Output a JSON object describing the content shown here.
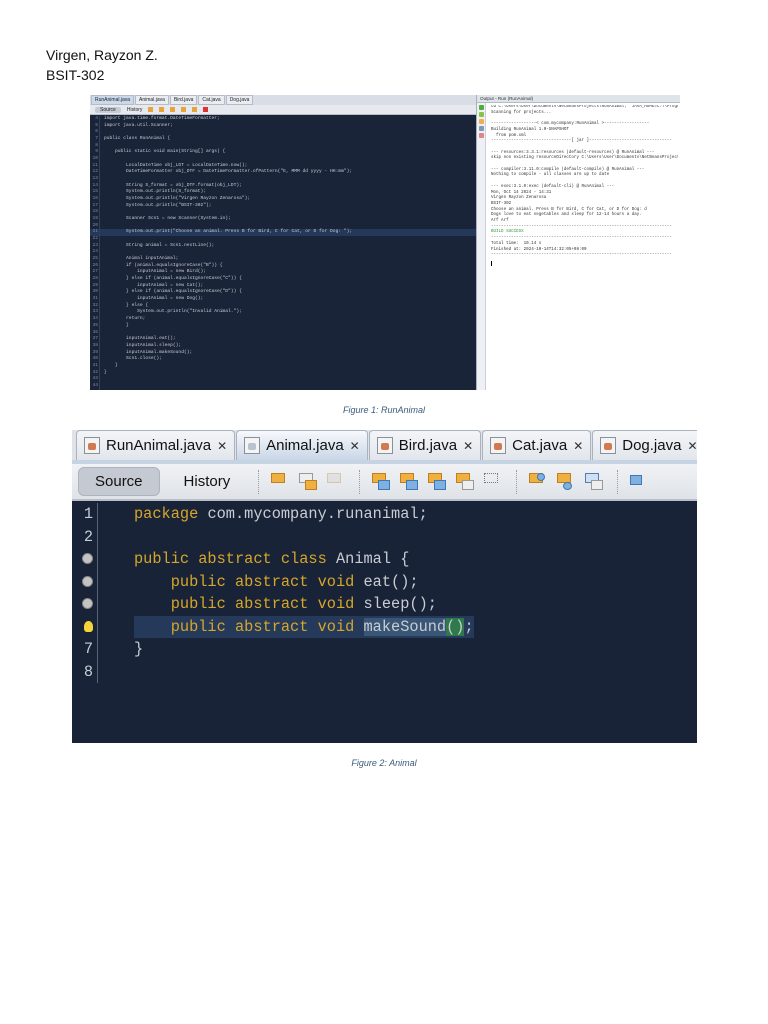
{
  "author": {
    "name": "Virgen, Rayzon Z.",
    "section": "BSIT-302"
  },
  "figure1": {
    "caption": "Figure 1: RunAnimal",
    "tabs": [
      "RunAnimal.java",
      "Animal.java",
      "Bird.java",
      "Cat.java",
      "Dog.java"
    ],
    "active_tab": 0,
    "toolbar": {
      "source_label": "Source",
      "history_label": "History"
    },
    "code_lines": [
      {
        "n": "4",
        "code": "import java.time.format.DateTimeFormatter;"
      },
      {
        "n": "5",
        "code": "import java.util.Scanner;"
      },
      {
        "n": "6",
        "code": ""
      },
      {
        "n": "7",
        "code": "public class RunAnimal {"
      },
      {
        "n": "8",
        "code": ""
      },
      {
        "n": "9",
        "code": "    public static void main(String[] args) {"
      },
      {
        "n": "10",
        "code": ""
      },
      {
        "n": "11",
        "code": "        LocalDateTime obj_LDT = LocalDateTime.now();"
      },
      {
        "n": "12",
        "code": "        DateTimeFormatter obj_DTF = DateTimeFormatter.ofPattern(\"E, MMM dd yyyy - HH:mm\");"
      },
      {
        "n": "13",
        "code": ""
      },
      {
        "n": "14",
        "code": "        String S_format = obj_DTF.format(obj_LDT);"
      },
      {
        "n": "15",
        "code": "        System.out.println(S_format);"
      },
      {
        "n": "16",
        "code": "        System.out.println(\"Virgen Rayzon Zenarosa\");"
      },
      {
        "n": "17",
        "code": "        System.out.println(\"BSIT-302\");"
      },
      {
        "n": "18",
        "code": ""
      },
      {
        "n": "19",
        "code": "        Scanner Scn1 = new Scanner(System.in);"
      },
      {
        "n": "20",
        "code": ""
      },
      {
        "n": "21",
        "code": "        System.out.print(\"Choose an animal. Press B for Bird, C for Cat, or D for Dog: \");",
        "hl": true
      },
      {
        "n": "22",
        "code": ""
      },
      {
        "n": "23",
        "code": "        String animal = Scn1.nextLine();"
      },
      {
        "n": "24",
        "code": ""
      },
      {
        "n": "25",
        "code": "        Animal inputAnimal;"
      },
      {
        "n": "26",
        "code": "        if (animal.equalsIgnoreCase(\"B\")) {"
      },
      {
        "n": "27",
        "code": "            inputAnimal = new Bird();"
      },
      {
        "n": "28",
        "code": "        } else if (animal.equalsIgnoreCase(\"C\")) {"
      },
      {
        "n": "29",
        "code": "            inputAnimal = new Cat();"
      },
      {
        "n": "30",
        "code": "        } else if (animal.equalsIgnoreCase(\"D\")) {"
      },
      {
        "n": "31",
        "code": "            inputAnimal = new Dog();"
      },
      {
        "n": "32",
        "code": "        } else {"
      },
      {
        "n": "33",
        "code": "            System.out.println(\"Invalid Animal.\");"
      },
      {
        "n": "34",
        "code": "        return;"
      },
      {
        "n": "35",
        "code": "        }"
      },
      {
        "n": "36",
        "code": ""
      },
      {
        "n": "37",
        "code": "        inputAnimal.eat();"
      },
      {
        "n": "38",
        "code": "        inputAnimal.sleep();"
      },
      {
        "n": "39",
        "code": "        inputAnimal.makeSound();"
      },
      {
        "n": "40",
        "code": "        Scn1.close();"
      },
      {
        "n": "41",
        "code": "    }"
      },
      {
        "n": "42",
        "code": "}"
      },
      {
        "n": "43",
        "code": ""
      },
      {
        "n": "44",
        "code": ""
      }
    ],
    "output": {
      "title": "Output - Run (RunAnimal)",
      "lines": [
        "cd C:\\Users\\User\\Documents\\NetBeansProjects\\RunAnimal; \"JAVA_HOME=C:\\\\Progra",
        "Scanning for projects...",
        "",
        "------------------< com.mycompany:RunAnimal >------------------",
        "Building RunAnimal 1.0-SNAPSHOT",
        "  from pom.xml",
        "--------------------------------[ jar ]---------------------------------",
        "",
        "--- resources:3.3.1:resources (default-resources) @ RunAnimal ---",
        "skip non existing resourceDirectory C:\\Users\\User\\Documents\\NetBeansProjects",
        "",
        "--- compiler:3.11.0:compile (default-compile) @ RunAnimal ---",
        "Nothing to compile - all classes are up to date",
        "",
        "--- exec:3.1.0:exec (default-cli) @ RunAnimal ---",
        "Mon, Oct 14 2024 - 14:31",
        "Virgen Rayzon Zenarosa",
        "BSIT-302",
        "Choose an animal. Press B for Bird, C for Cat, or D for Dog: d",
        "Dogs love to eat vegetables and sleep for 12-14 hours a day.",
        "Arf Arf",
        "------------------------------------------------------------------------",
        "BUILD SUCCESS",
        "------------------------------------------------------------------------",
        "Total time:  10.14 s",
        "Finished at: 2024-10-14T14:32:05+08:00",
        "------------------------------------------------------------------------"
      ]
    }
  },
  "figure2": {
    "caption": "Figure 2: Animal",
    "tabs": [
      "RunAnimal.java",
      "Animal.java",
      "Bird.java",
      "Cat.java",
      "Dog.java"
    ],
    "active_tab": 1,
    "toolbar": {
      "source_label": "Source",
      "history_label": "History"
    },
    "code_lines": [
      {
        "n": "1",
        "tokens": [
          [
            "package",
            "kw"
          ],
          [
            " com.mycompany.runanimal;",
            ""
          ]
        ]
      },
      {
        "n": "2",
        "tokens": []
      },
      {
        "n": "",
        "gutter": "override-icon",
        "tokens": [
          [
            "public abstract class",
            "kw"
          ],
          [
            " Animal {",
            ""
          ]
        ]
      },
      {
        "n": "",
        "gutter": "override-icon",
        "tokens": [
          [
            "    ",
            ""
          ],
          [
            "public abstract void",
            "kw"
          ],
          [
            " eat();",
            ""
          ]
        ]
      },
      {
        "n": "",
        "gutter": "override-icon",
        "tokens": [
          [
            "    ",
            ""
          ],
          [
            "public abstract void",
            "kw"
          ],
          [
            " sleep();",
            ""
          ]
        ]
      },
      {
        "n": "",
        "gutter": "lightbulb-icon",
        "hl": true,
        "tokens": [
          [
            "    ",
            ""
          ],
          [
            "public abstract void",
            "kw"
          ],
          [
            " ",
            ""
          ],
          [
            "makeSound",
            "mark"
          ],
          [
            "()",
            "brace"
          ],
          [
            ";",
            ""
          ]
        ]
      },
      {
        "n": "7",
        "tokens": [
          [
            "}",
            ""
          ]
        ]
      },
      {
        "n": "8",
        "tokens": []
      }
    ]
  }
}
